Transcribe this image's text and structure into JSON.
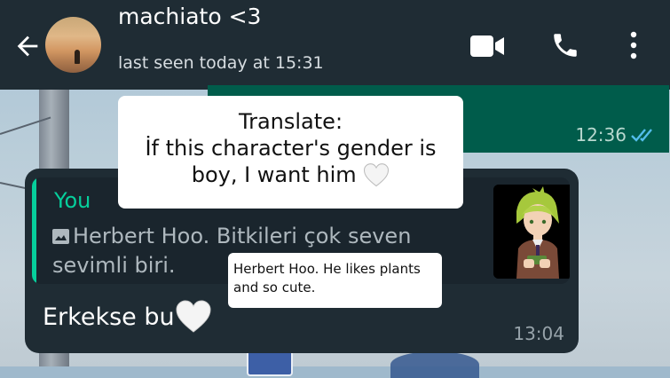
{
  "header": {
    "contact_name": "machiato <3",
    "last_seen": "last seen today at 15:31"
  },
  "outgoing": {
    "time": "12:36"
  },
  "incoming": {
    "quote_author": "You",
    "quote_text": "Herbert Hoo. Bitkileri çok seven sevimli biri.",
    "message": "Erkekse bu",
    "time": "13:04"
  },
  "overlay": {
    "line1": "Translate:",
    "line2": "İf this character's gender is",
    "line3": "boy, I want him",
    "note": "Herbert Hoo. He likes plants and so cute."
  },
  "colors": {
    "header_bg": "#1f2c34",
    "outgoing_bg": "#005c4b",
    "incoming_bg": "#1f2c34",
    "accent": "#06cf9c",
    "read_ticks": "#53bdeb"
  },
  "icons": [
    "back-arrow-icon",
    "video-call-icon",
    "phone-call-icon",
    "more-options-icon",
    "photo-icon",
    "double-check-icon",
    "white-heart-icon"
  ]
}
